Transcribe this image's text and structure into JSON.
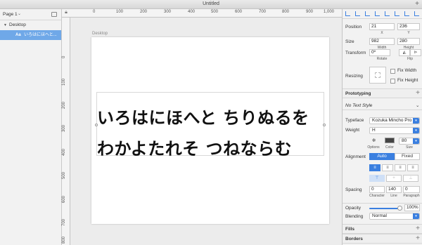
{
  "window": {
    "title": "Untitled",
    "add_label": "+"
  },
  "layers": {
    "page_label": "Page 1",
    "desktop_label": "Desktop",
    "text_layer_icon": "Aa",
    "text_layer_name": "いろはにほへと..."
  },
  "ruler_top": [
    "0",
    "100",
    "200",
    "300",
    "400",
    "500",
    "600",
    "700",
    "800",
    "900",
    "1,000"
  ],
  "ruler_left": [
    "0",
    "100",
    "200",
    "300",
    "400",
    "500",
    "600",
    "700",
    "800",
    "900"
  ],
  "canvas": {
    "artboard_label": "Desktop",
    "text_line1": "いろはにほへと ちりぬるを",
    "text_line2": "わかよたれそ つねならむ"
  },
  "inspector": {
    "position_label": "Position",
    "x_value": "21",
    "y_value": "236",
    "x_label": "X",
    "y_label": "Y",
    "size_label": "Size",
    "width_value": "982",
    "height_value": "280",
    "width_label": "Width",
    "height_label": "Height",
    "transform_label": "Transform",
    "rotate_value": "0º",
    "rotate_label": "Rotate",
    "flip_label": "Flip",
    "resizing_label": "Resizing",
    "fix_width_label": "Fix Width",
    "fix_height_label": "Fix Height",
    "prototyping_label": "Prototyping",
    "text_style_value": "No Text Style",
    "typeface_label": "Typeface",
    "typeface_value": "Kozuka Mincho Pro",
    "weight_label": "Weight",
    "weight_value": "H",
    "options_label": "Options",
    "color_label": "Color",
    "size_value": "80",
    "size_sub_label": "Size",
    "alignment_label": "Alignment",
    "auto_label": "Auto",
    "fixed_label": "Fixed",
    "spacing_label": "Spacing",
    "character_value": "0",
    "line_value": "140",
    "paragraph_value": "0",
    "character_label": "Character",
    "line_label": "Line",
    "paragraph_label": "Paragraph",
    "opacity_label": "Opacity",
    "opacity_value": "100%",
    "opacity_fraction": 1.0,
    "blending_label": "Blending",
    "blending_value": "Normal",
    "fills_label": "Fills",
    "borders_label": "Borders",
    "accent_color": "#3a7fe0",
    "text_color_swatch": "#444444"
  }
}
